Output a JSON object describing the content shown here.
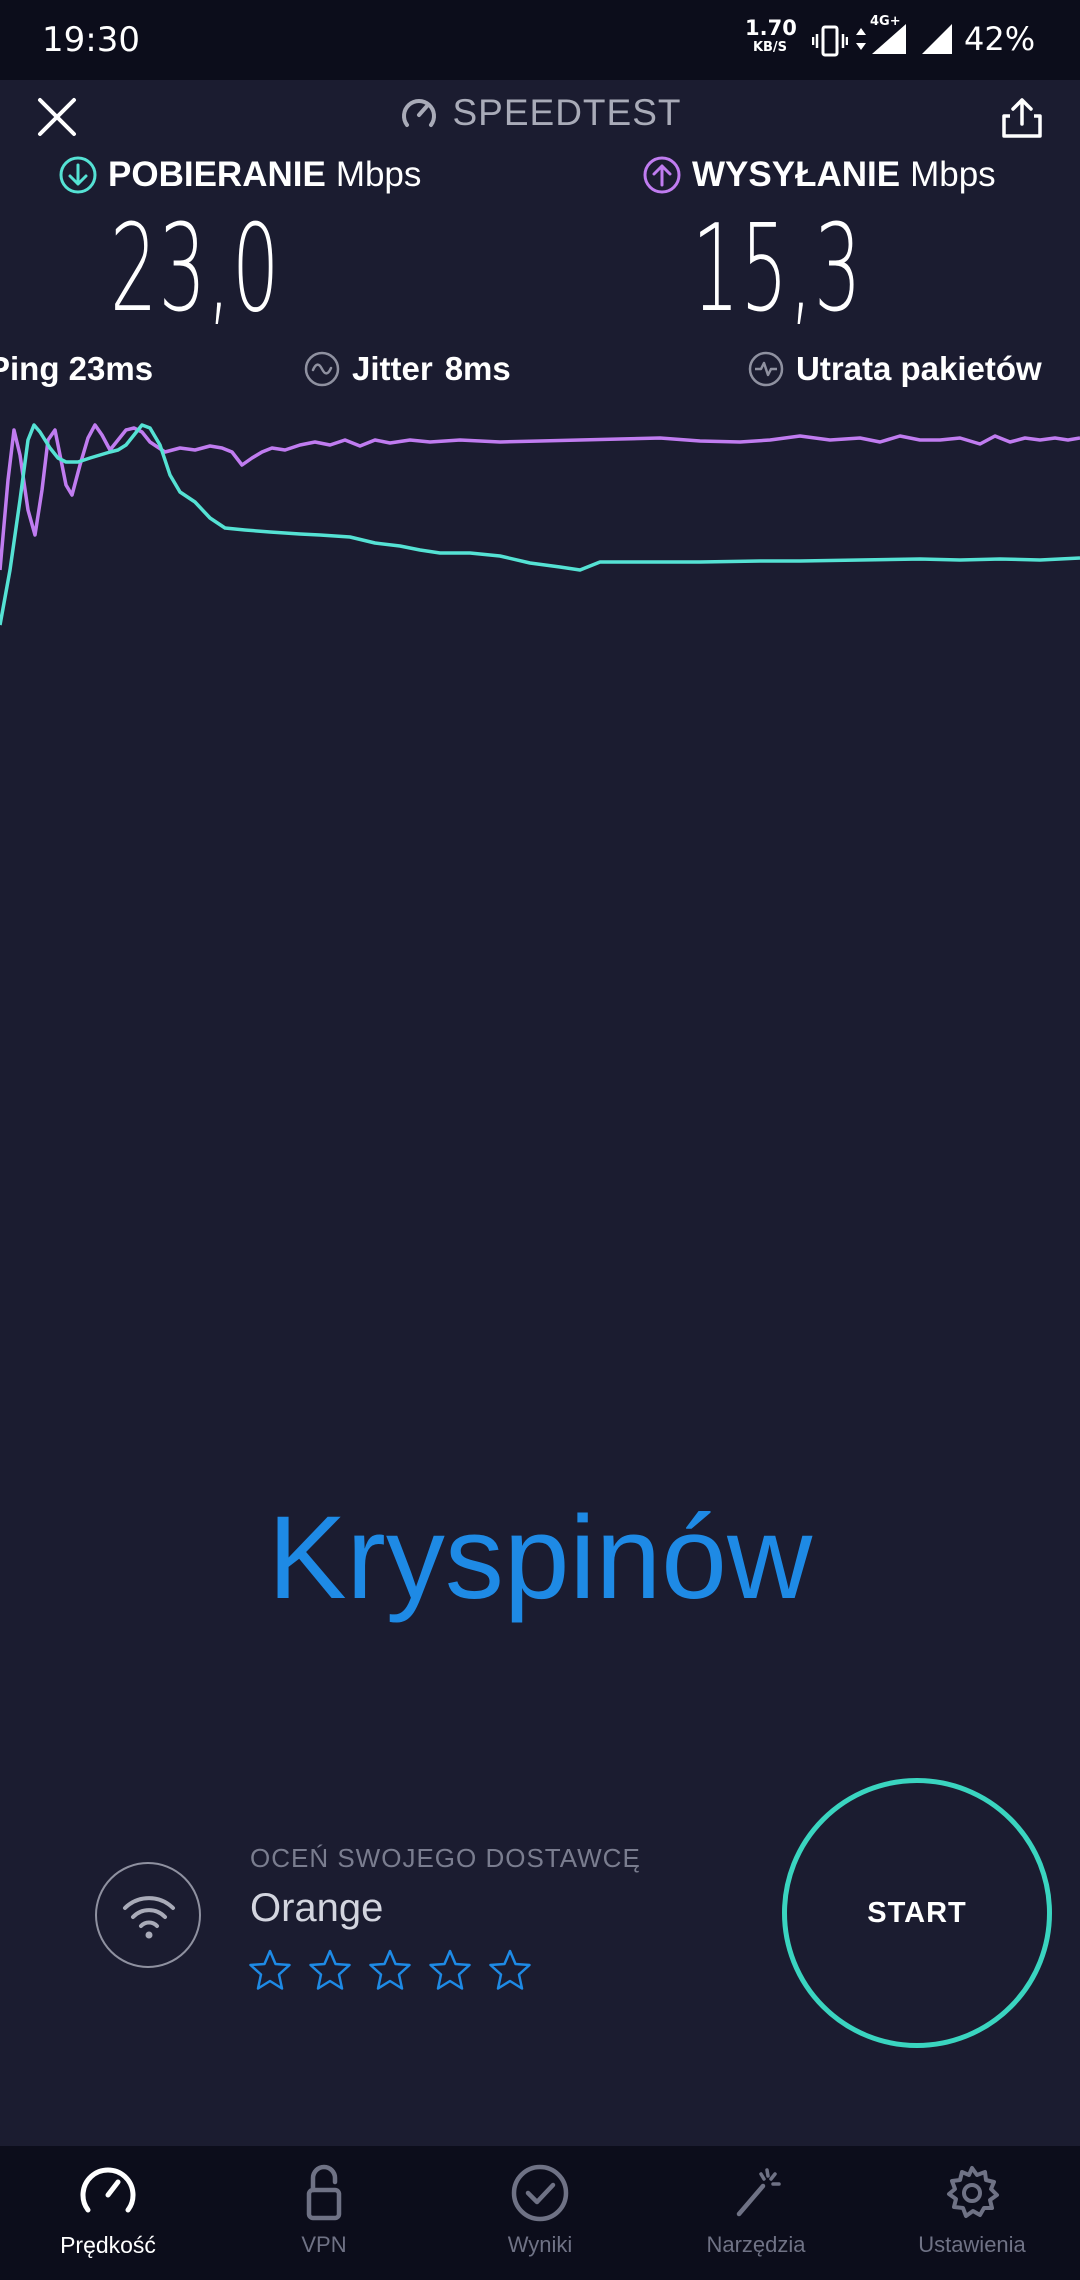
{
  "status_bar": {
    "time": "19:30",
    "net_speed": "1.70",
    "net_speed_unit": "KB/S",
    "network_type": "4G+",
    "battery": "42%"
  },
  "header": {
    "title": "SPEEDTEST",
    "close_icon": "close-icon",
    "share_icon": "share-icon"
  },
  "download": {
    "label": "POBIERANIE",
    "unit": "Mbps",
    "value": "23,0",
    "color": "#55e2d4"
  },
  "upload": {
    "label": "WYSYŁANIE",
    "unit": "Mbps",
    "value": "15,3",
    "color": "#c07cf0"
  },
  "stats": {
    "ping_text": "Ping 23ms",
    "jitter_label": "Jitter",
    "jitter_value": "8ms",
    "loss_label": "Utrata pakietów"
  },
  "location": "Kryspinów",
  "provider": {
    "rate_prompt": "OCEŃ SWOJEGO DOSTAWCĘ",
    "name": "Orange",
    "rating_stars": 5,
    "star_color": "#1e8ae5"
  },
  "start_button": {
    "label": "START",
    "ring_color": "#3ad5c0"
  },
  "bottom_nav": [
    {
      "label": "Prędkość",
      "icon": "speedometer-icon",
      "active": true
    },
    {
      "label": "VPN",
      "icon": "lock-icon",
      "active": false
    },
    {
      "label": "Wyniki",
      "icon": "check-circle-icon",
      "active": false
    },
    {
      "label": "Narzędzia",
      "icon": "magic-wand-icon",
      "active": false
    },
    {
      "label": "Ustawienia",
      "icon": "gear-icon",
      "active": false
    }
  ]
}
